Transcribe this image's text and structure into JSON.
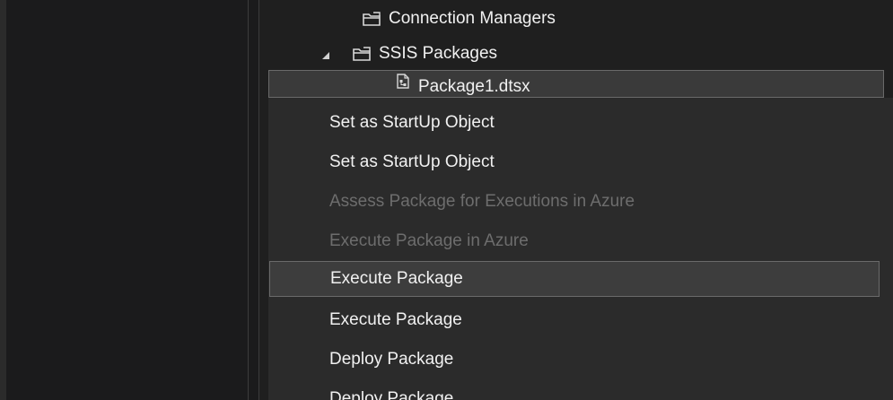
{
  "tree": {
    "items": [
      {
        "label": "Connection Managers",
        "icon": "folder-icon"
      },
      {
        "label": "SSIS Packages",
        "icon": "folder-icon",
        "expanded": true
      },
      {
        "label": "Package1.dtsx",
        "icon": "ssis-package-icon",
        "selected": true
      }
    ]
  },
  "context_menu": {
    "items": [
      {
        "label": "Set as StartUp Object",
        "enabled": true
      },
      {
        "label": "Set as StartUp Object",
        "enabled": true
      },
      {
        "label": "Assess Package for Executions in Azure",
        "enabled": false
      },
      {
        "label": "Execute Package in Azure",
        "enabled": false
      },
      {
        "label": "Execute Package",
        "enabled": true,
        "highlighted": true
      },
      {
        "label": "Execute Package",
        "enabled": true
      },
      {
        "label": "Deploy Package",
        "enabled": true
      },
      {
        "label": "Deploy Package",
        "enabled": true
      }
    ]
  },
  "colors": {
    "background": "#1f1f1f",
    "menu_background": "#2b2b2b",
    "highlight": "#3d3d3d",
    "text": "#f1f1f1",
    "disabled_text": "#6d6d6d"
  }
}
